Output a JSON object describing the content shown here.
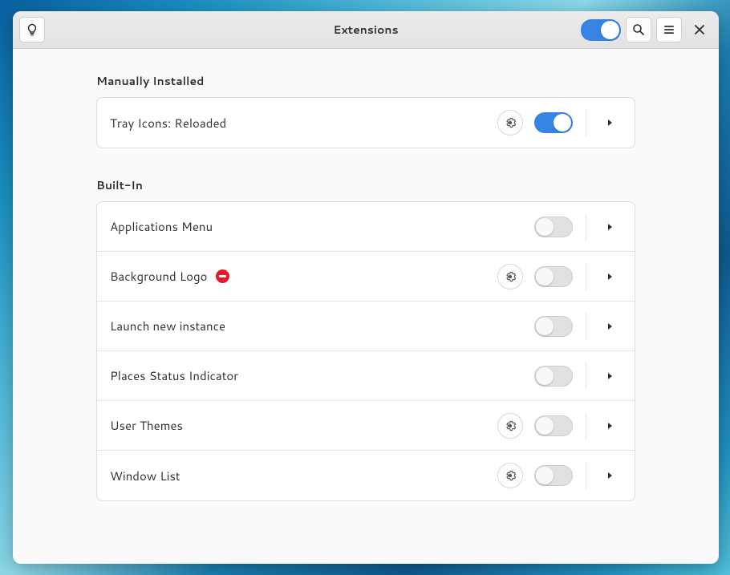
{
  "header": {
    "title": "Extensions",
    "global_toggle": true
  },
  "sections": [
    {
      "id": "manual",
      "title": "Manually Installed",
      "items": [
        {
          "name": "Tray Icons: Reloaded",
          "enabled": true,
          "has_settings": true,
          "has_error": false
        }
      ]
    },
    {
      "id": "builtin",
      "title": "Built-In",
      "items": [
        {
          "name": "Applications Menu",
          "enabled": false,
          "has_settings": false,
          "has_error": false
        },
        {
          "name": "Background Logo",
          "enabled": false,
          "has_settings": true,
          "has_error": true
        },
        {
          "name": "Launch new instance",
          "enabled": false,
          "has_settings": false,
          "has_error": false
        },
        {
          "name": "Places Status Indicator",
          "enabled": false,
          "has_settings": false,
          "has_error": false
        },
        {
          "name": "User Themes",
          "enabled": false,
          "has_settings": true,
          "has_error": false
        },
        {
          "name": "Window List",
          "enabled": false,
          "has_settings": true,
          "has_error": false
        }
      ]
    }
  ],
  "icons": {
    "search": "search-icon",
    "hamburger": "hamburger-icon",
    "close": "close-icon",
    "gear": "gear-icon",
    "chevron_right": "chevron-right-icon",
    "lightbulb": "lightbulb-icon"
  }
}
